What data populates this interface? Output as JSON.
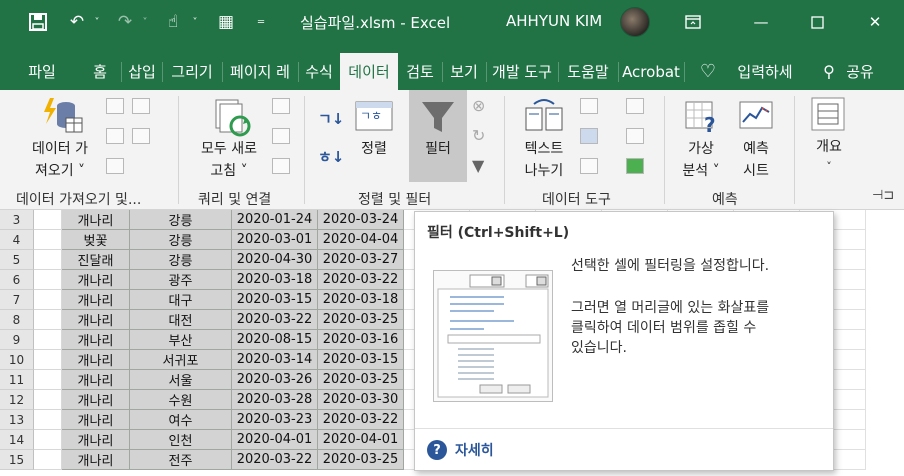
{
  "titlebar": {
    "doc_title": "실습파일.xlsm  -  Excel",
    "user_name": "AHHYUN KIM",
    "icons": [
      "save-icon",
      "undo-icon",
      "redo-icon",
      "touch-mode-icon",
      "form-icon",
      "customize-qat-icon",
      "ribbon-display-icon",
      "minimize-icon",
      "maximize-icon",
      "close-icon"
    ]
  },
  "tabs": [
    "파일",
    "홈",
    "삽입",
    "그리기",
    "페이지 레",
    "수식",
    "데이터",
    "검토",
    "보기",
    "개발 도구",
    "도움말",
    "Acrobat"
  ],
  "tell_me": "입력하세",
  "share": "공유",
  "ribbon": {
    "get_data": {
      "line1": "데이터 가",
      "line2": "져오기 ˅"
    },
    "refresh": {
      "line1": "모두 새로",
      "line2": "고침 ˅"
    },
    "sort": "정렬",
    "filter": "필터",
    "text_to_columns": {
      "line1": "텍스트",
      "line2": "나누기"
    },
    "what_if": {
      "line1": "가상",
      "line2": "분석 ˅"
    },
    "forecast_sheet": {
      "line1": "예측",
      "line2": "시트"
    },
    "outline": {
      "line1": "개요",
      "line2": "˅"
    },
    "groups": [
      "데이터 가져오기 및...",
      "쿼리 및 연결",
      "정렬 및 필터",
      "데이터 도구",
      "예측"
    ]
  },
  "sheet": {
    "rows": [
      {
        "n": "3",
        "flower": "개나리",
        "city": "강릉",
        "d1": "2020-01-24",
        "d2": "2020-03-24"
      },
      {
        "n": "4",
        "flower": "벚꽃",
        "city": "강릉",
        "d1": "2020-03-01",
        "d2": "2020-04-04"
      },
      {
        "n": "5",
        "flower": "진달래",
        "city": "강릉",
        "d1": "2020-04-30",
        "d2": "2020-03-27"
      },
      {
        "n": "6",
        "flower": "개나리",
        "city": "광주",
        "d1": "2020-03-18",
        "d2": "2020-03-22"
      },
      {
        "n": "7",
        "flower": "개나리",
        "city": "대구",
        "d1": "2020-03-15",
        "d2": "2020-03-18"
      },
      {
        "n": "8",
        "flower": "개나리",
        "city": "대전",
        "d1": "2020-03-22",
        "d2": "2020-03-25"
      },
      {
        "n": "9",
        "flower": "개나리",
        "city": "부산",
        "d1": "2020-08-15",
        "d2": "2020-03-16"
      },
      {
        "n": "10",
        "flower": "개나리",
        "city": "서귀포",
        "d1": "2020-03-14",
        "d2": "2020-03-15"
      },
      {
        "n": "11",
        "flower": "개나리",
        "city": "서울",
        "d1": "2020-03-26",
        "d2": "2020-03-25"
      },
      {
        "n": "12",
        "flower": "개나리",
        "city": "수원",
        "d1": "2020-03-28",
        "d2": "2020-03-30"
      },
      {
        "n": "13",
        "flower": "개나리",
        "city": "여수",
        "d1": "2020-03-23",
        "d2": "2020-03-22"
      },
      {
        "n": "14",
        "flower": "개나리",
        "city": "인천",
        "d1": "2020-04-01",
        "d2": "2020-04-01"
      },
      {
        "n": "15",
        "flower": "개나리",
        "city": "전주",
        "d1": "2020-03-22",
        "d2": "2020-03-25"
      }
    ]
  },
  "tooltip": {
    "title": "필터 (Ctrl+Shift+L)",
    "desc1": "선택한 셀에 필터링을 설정합니다.",
    "desc2_l1": "그러면 열 머리글에 있는 화살표를",
    "desc2_l2": "클릭하여 데이터 범위를 좁힐 수",
    "desc2_l3": "있습니다.",
    "help": "자세히"
  },
  "colors": {
    "excel_green": "#217346",
    "ribbon_bg": "#f3f3f3",
    "help_blue": "#2b579a"
  }
}
